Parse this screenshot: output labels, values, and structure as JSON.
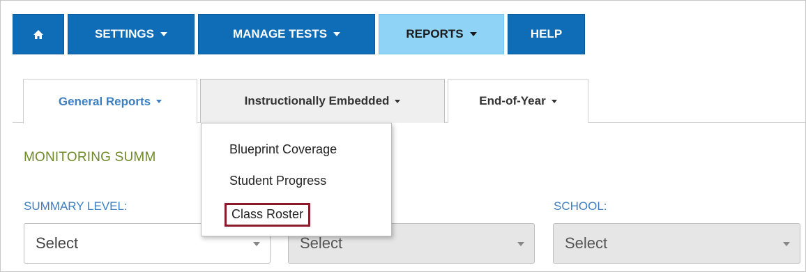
{
  "nav": {
    "home_icon": "home-icon",
    "settings": "SETTINGS",
    "manage_tests": "MANAGE TESTS",
    "reports": "REPORTS",
    "help": "HELP"
  },
  "tabs": {
    "general": "General Reports",
    "embedded": "Instructionally Embedded",
    "eoy": "End-of-Year"
  },
  "menu": {
    "items": [
      "Blueprint Coverage",
      "Student Progress",
      "Class Roster"
    ],
    "highlight_color": "#8b1a2b"
  },
  "page": {
    "section_title": "MONITORING SUMM",
    "summary_level_label": "SUMMARY LEVEL:",
    "school_label": "SCHOOL:",
    "select1": "Select",
    "select2": "Select",
    "select3": "Select"
  },
  "colors": {
    "nav_blue": "#0f6cb6",
    "nav_active": "#8fd3f7",
    "label_blue": "#3c7fc2",
    "title_green": "#6f8a2a"
  }
}
